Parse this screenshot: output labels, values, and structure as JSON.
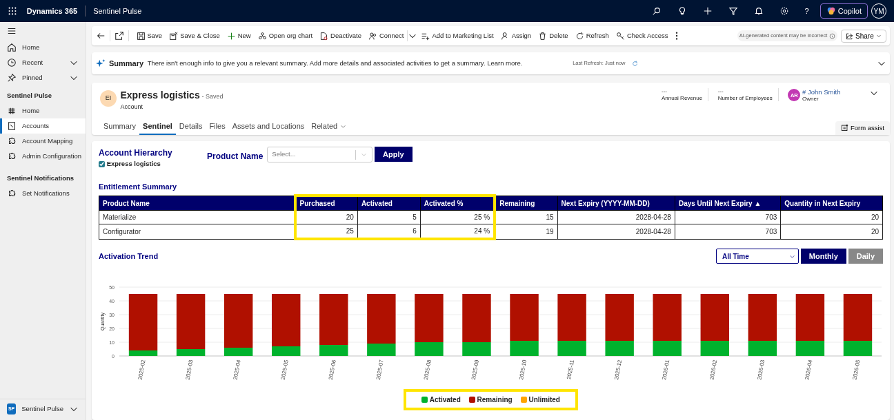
{
  "app_bar": {
    "title": "Dynamics 365",
    "app_name": "Sentinel Pulse",
    "help": "?",
    "copilot": "Copilot",
    "user_initials": "YM"
  },
  "sidebar": {
    "top_items": [
      {
        "label": "Home",
        "expandable": false
      },
      {
        "label": "Recent",
        "expandable": true
      },
      {
        "label": "Pinned",
        "expandable": true
      }
    ],
    "groups": [
      {
        "title": "Sentinel Pulse",
        "items": [
          {
            "label": "Home",
            "selected": false
          },
          {
            "label": "Accounts",
            "selected": true
          },
          {
            "label": "Account Mapping",
            "selected": false
          },
          {
            "label": "Admin Configuration",
            "selected": false
          }
        ]
      },
      {
        "title": "Sentinel Notifications",
        "items": [
          {
            "label": "Set Notifications",
            "selected": false
          }
        ]
      }
    ],
    "area_switcher": {
      "initials": "SP",
      "label": "Sentinel Pulse"
    }
  },
  "command_bar": {
    "commands": [
      "Save",
      "Save & Close",
      "New",
      "Open org chart",
      "Deactivate",
      "Connect",
      "Add to Marketing List",
      "Assign",
      "Delete",
      "Refresh",
      "Check Access"
    ],
    "ai_notice": "AI-generated content may be incorrect",
    "share": "Share"
  },
  "summary": {
    "title": "Summary",
    "text": "There isn't enough info to give you a relevant summary. Add more details and associated activities to get a summary. Learn more.",
    "last_refresh": "Last Refresh: Just now"
  },
  "record": {
    "initials": "EI",
    "name": "Express logistics",
    "status": "- Saved",
    "entity": "Account",
    "fields": [
      {
        "value": "---",
        "label": "Annual Revenue"
      },
      {
        "value": "---",
        "label": "Number of Employees"
      }
    ],
    "owner": {
      "initials": "AR",
      "name": "# John Smith",
      "label": "Owner"
    },
    "tabs": [
      {
        "label": "Summary",
        "selected": false
      },
      {
        "label": "Sentinel",
        "selected": true
      },
      {
        "label": "Details",
        "selected": false
      },
      {
        "label": "Files",
        "selected": false
      },
      {
        "label": "Assets and Locations",
        "selected": false
      },
      {
        "label": "Related",
        "selected": false
      }
    ],
    "form_assist": "Form assist"
  },
  "hierarchy": {
    "title": "Account Hierarchy",
    "items": [
      {
        "label": "Express logistics",
        "checked": true
      }
    ]
  },
  "product_filter": {
    "label": "Product Name",
    "placeholder": "Select...",
    "button": "Apply"
  },
  "entitlement": {
    "title": "Entitlement Summary",
    "columns": [
      {
        "label": "Product Name",
        "highlighted": false
      },
      {
        "label": "Purchased",
        "highlighted": true
      },
      {
        "label": "Activated",
        "highlighted": true
      },
      {
        "label": "Activated %",
        "highlighted": true
      },
      {
        "label": "Remaining",
        "highlighted": false
      },
      {
        "label": "Next Expiry (YYYY-MM-DD)",
        "highlighted": false
      },
      {
        "label": "Days Until Next Expiry ▲",
        "highlighted": false
      },
      {
        "label": "Quantity in Next Expiry",
        "highlighted": false
      }
    ],
    "rows": [
      [
        "Materialize",
        "20",
        "5",
        "25 %",
        "15",
        "2028-04-28",
        "703",
        "20"
      ],
      [
        "Configurator",
        "25",
        "6",
        "24 %",
        "19",
        "2028-04-28",
        "703",
        "20"
      ]
    ]
  },
  "trend": {
    "title": "Activation Trend",
    "range": "All Time",
    "granularity": [
      {
        "label": "Monthly",
        "selected": true
      },
      {
        "label": "Daily",
        "selected": false
      }
    ],
    "chart_data": {
      "type": "bar",
      "stacked": true,
      "grid": true,
      "ylabel": "Quantity",
      "ylim": [
        0,
        50
      ],
      "yticks": [
        0,
        10,
        20,
        30,
        40,
        50
      ],
      "categories": [
        "2025-02",
        "2025-03",
        "2025-04",
        "2025-05",
        "2025-06",
        "2025-07",
        "2025-08",
        "2025-09",
        "2025-10",
        "2025-11",
        "2025-12",
        "2026-01",
        "2026-02",
        "2026-03",
        "2026-04",
        "2026-05"
      ],
      "series": [
        {
          "name": "Activated",
          "color": "#00b22d",
          "values": [
            4,
            5,
            6,
            7,
            8,
            9,
            10,
            10,
            11,
            11,
            11,
            11,
            11,
            11,
            11,
            11
          ]
        },
        {
          "name": "Remaining",
          "color": "#b01000",
          "values": [
            41,
            40,
            39,
            38,
            37,
            36,
            35,
            35,
            34,
            34,
            34,
            34,
            34,
            34,
            34,
            34
          ]
        }
      ]
    },
    "legend_highlighted": true,
    "legend_extra": [
      {
        "label": "Unlimited",
        "color": "#ffa500"
      }
    ]
  }
}
